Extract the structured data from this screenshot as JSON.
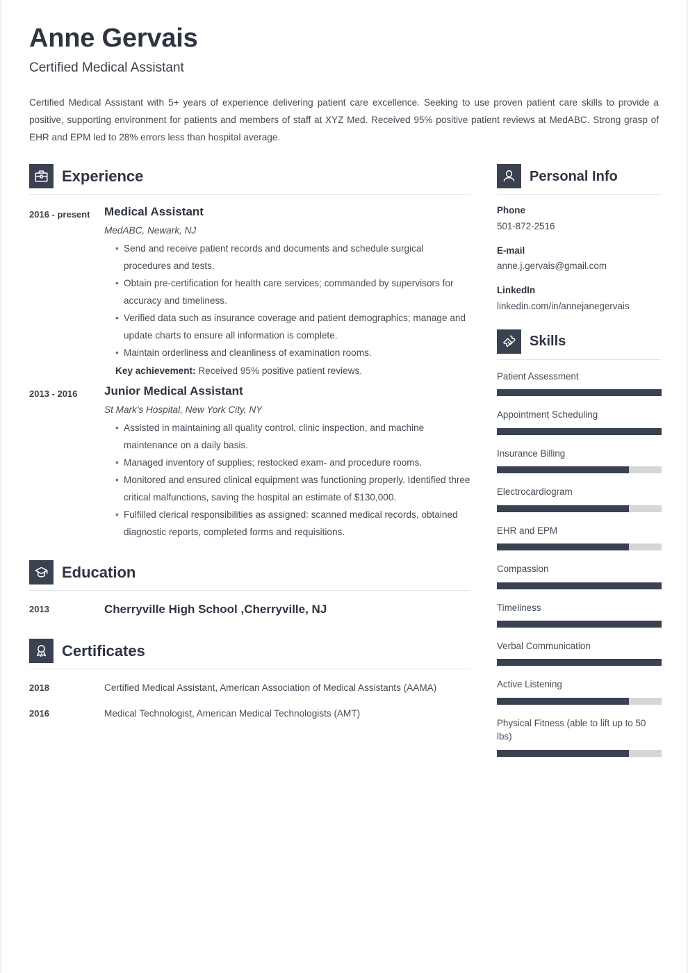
{
  "header": {
    "name": "Anne Gervais",
    "job_title": "Certified Medical Assistant",
    "summary": "Certified Medical Assistant with 5+ years of experience delivering patient care excellence. Seeking to use proven patient care skills to provide a positive, supporting environment for patients and members of staff at XYZ Med. Received 95% positive patient reviews at MedABC. Strong grasp of EHR and EPM led to 28% errors less than hospital average."
  },
  "colors": {
    "accent": "#3a4150",
    "heading": "#2e3440",
    "body_text": "#454b55",
    "rule": "#e2e4e7",
    "skill_track": "#d4d6d8"
  },
  "sections": {
    "experience": {
      "title": "Experience",
      "icon": "briefcase-icon",
      "entries": [
        {
          "date": "2016 - present",
          "role": "Medical Assistant",
          "org": "MedABC, Newark, NJ",
          "bullets": [
            "Send and receive patient records and documents and schedule surgical procedures and tests.",
            "Obtain pre-certification for health care services; commanded by supervisors for accuracy and timeliness.",
            "Verified data such as insurance coverage and patient demographics; manage and update charts to ensure all information is complete.",
            "Maintain orderliness and cleanliness of examination rooms."
          ],
          "key_achievement_label": "Key achievement:",
          "key_achievement_text": " Received 95% positive patient reviews."
        },
        {
          "date": "2013 - 2016",
          "role": "Junior Medical Assistant",
          "org": "St Mark's Hospital, New York City, NY",
          "bullets": [
            "Assisted in maintaining all quality control, clinic inspection, and machine maintenance on a daily basis.",
            "Managed inventory of supplies; restocked exam- and procedure rooms.",
            "Monitored and ensured clinical equipment was functioning properly. Identified three critical malfunctions, saving the hospital an estimate of $130,000.",
            "Fulfilled clerical responsibilities as assigned: scanned medical records, obtained diagnostic reports, completed forms and requisitions."
          ]
        }
      ]
    },
    "education": {
      "title": "Education",
      "icon": "graduation-cap-icon",
      "entries": [
        {
          "date": "2013",
          "text": "Cherryville High School ,Cherryville, NJ"
        }
      ]
    },
    "certificates": {
      "title": "Certificates",
      "icon": "award-ribbon-icon",
      "entries": [
        {
          "date": "2018",
          "text": "Certified Medical Assistant, American Association of Medical Assistants (AAMA)"
        },
        {
          "date": "2016",
          "text": "Medical Technologist, American Medical Technologists (AMT)"
        }
      ]
    },
    "personal_info": {
      "title": "Personal Info",
      "icon": "person-icon",
      "fields": [
        {
          "label": "Phone",
          "value": "501-872-2516"
        },
        {
          "label": "E-mail",
          "value": "anne.j.gervais@gmail.com"
        },
        {
          "label": "LinkedIn",
          "value": "linkedin.com/in/annejanegervais"
        }
      ]
    },
    "skills": {
      "title": "Skills",
      "icon": "puzzle-piece-icon",
      "items": [
        {
          "name": "Patient Assessment",
          "level": 100
        },
        {
          "name": "Appointment Scheduling",
          "level": 100
        },
        {
          "name": "Insurance Billing",
          "level": 80
        },
        {
          "name": "Electrocardiogram",
          "level": 80
        },
        {
          "name": "EHR and EPM",
          "level": 80
        },
        {
          "name": "Compassion",
          "level": 100
        },
        {
          "name": "Timeliness",
          "level": 100
        },
        {
          "name": "Verbal Communication",
          "level": 100
        },
        {
          "name": "Active Listening",
          "level": 80
        },
        {
          "name": "Physical Fitness (able to lift up to 50 lbs)",
          "level": 80
        }
      ]
    }
  }
}
